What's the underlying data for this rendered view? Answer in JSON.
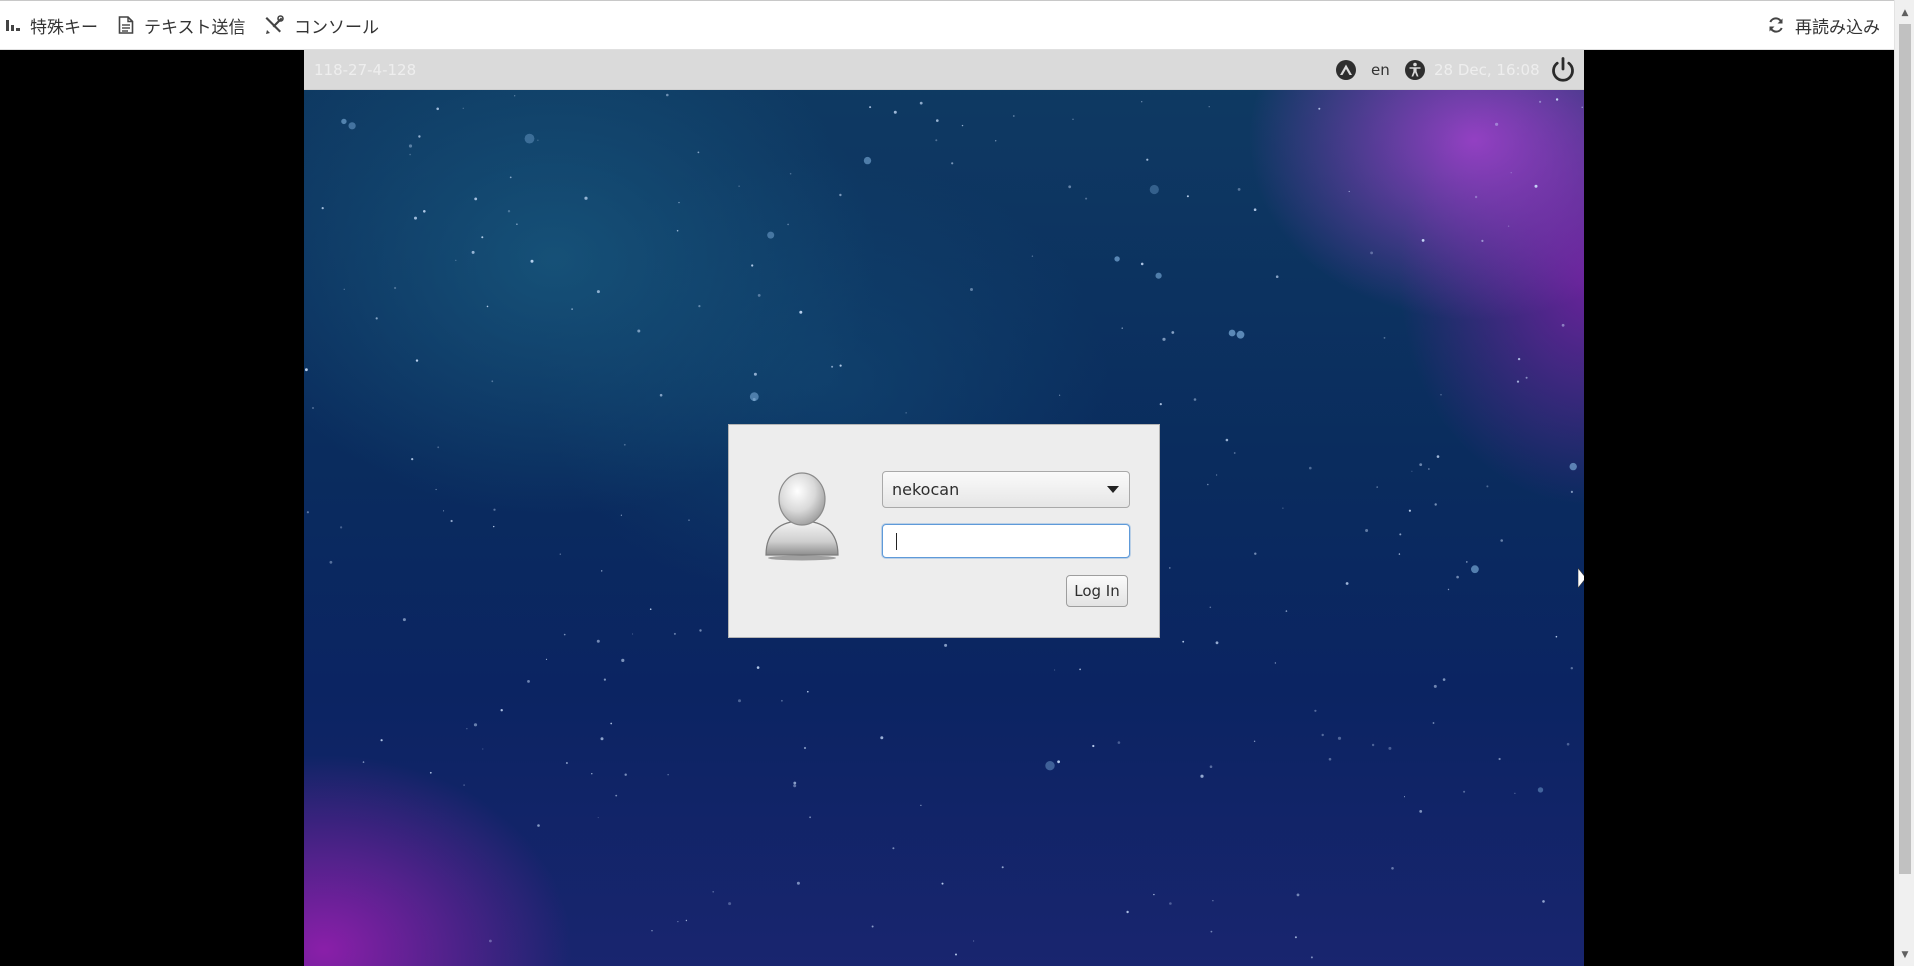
{
  "toolbar": {
    "special_keys_label": "特殊キー",
    "send_text_label": "テキスト送信",
    "console_label": "コンソール",
    "reload_label": "再読み込み"
  },
  "remote_screen": {
    "top_panel": {
      "hostname": "118-27-4-128",
      "keyboard_icon": "keyboard-layout-icon",
      "language": "en",
      "accessibility_icon": "accessibility-icon",
      "clock": "28 Dec, 16:08",
      "power_icon": "power-icon"
    },
    "login_dialog": {
      "avatar_icon": "user-avatar-icon",
      "selected_user": "nekocan",
      "password_value": "",
      "login_button_label": "Log In"
    }
  },
  "colors": {
    "toolbar_bg": "#ffffff",
    "panel_bg": "#dadada",
    "dialog_bg": "#ededed",
    "focus_border": "#5e9ad9",
    "wallpaper_primary": "#0a2c5e",
    "wallpaper_accent": "#a842d2"
  }
}
